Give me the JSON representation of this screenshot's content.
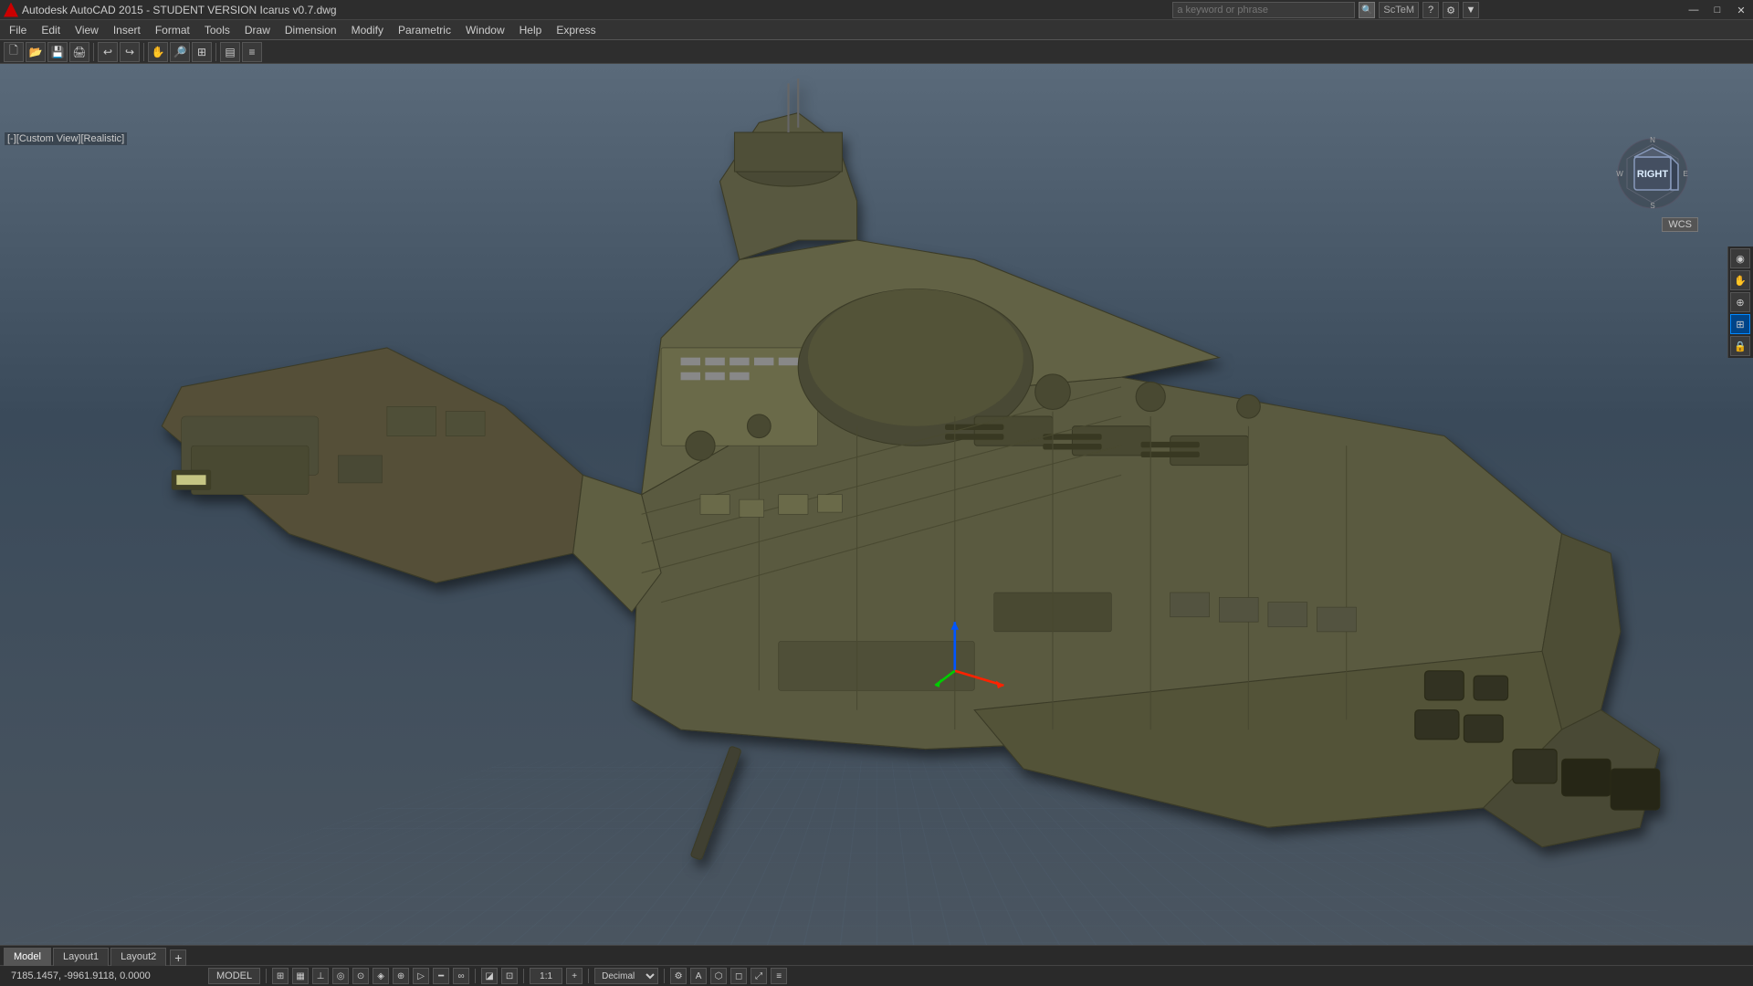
{
  "titlebar": {
    "title": "Autodesk AutoCAD 2015 - STUDENT VERSION    Icarus v0.7.dwg",
    "minimize": "—",
    "maximize": "□",
    "close": "✕"
  },
  "search": {
    "placeholder": "a keyword or phrase",
    "button_icon": "🔍",
    "user": "ScTeM"
  },
  "viewport": {
    "label": "[-][Custom View][Realistic]",
    "wcs": "WCS"
  },
  "coordinates": {
    "value": "7185.1457, -9961.9118, 0.0000"
  },
  "model_label": "MODEL",
  "tabs": [
    {
      "label": "Model",
      "active": true
    },
    {
      "label": "Layout1",
      "active": false
    },
    {
      "label": "Layout2",
      "active": false
    }
  ],
  "snap_options": [
    "Decimal"
  ],
  "toolbar": {
    "tools": [
      "New",
      "Open",
      "Save",
      "Print",
      "Undo",
      "Redo",
      "Pan",
      "Zoom"
    ]
  },
  "right_toolbar": {
    "tools": [
      "pan",
      "rotate",
      "zoom",
      "fit",
      "lock"
    ]
  },
  "status_tools": [
    "grid",
    "snap",
    "ortho",
    "polar",
    "osnap",
    "otrack",
    "ducs",
    "dyn",
    "lw",
    "tp"
  ]
}
